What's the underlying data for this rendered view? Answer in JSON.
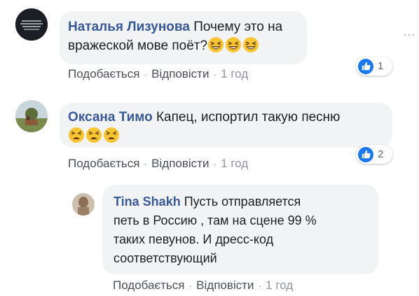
{
  "comments": [
    {
      "author": "Наталья Лизунова",
      "text_line1": "Почему это на",
      "text_line2": "вражеской мове поёт?",
      "emojis": [
        "laughing-face",
        "laughing-face",
        "laughing-face"
      ],
      "actions": {
        "like": "Подобається",
        "reply": "Відповісти",
        "time": "1 год"
      },
      "reaction_count": "1",
      "avatar": "dark-quote-image",
      "accent": "#385898"
    },
    {
      "author": "Оксана Тимо",
      "text_line1": "Капец, испортил такую песню",
      "emojis": [
        "tired-face",
        "tired-face",
        "tired-face"
      ],
      "actions": {
        "like": "Подобається",
        "reply": "Відповісти",
        "time": "1 год"
      },
      "reaction_count": "2",
      "avatar": "landscape-photo"
    },
    {
      "author": "Tina Shakh",
      "text_lines": [
        "Пусть отправляется",
        "петь в Россию , там на сцене 99 %",
        "таких певунов. И дресс-код",
        "соответствующий"
      ],
      "actions": {
        "like": "Подобається",
        "reply": "Відповісти",
        "time": "1 год"
      },
      "avatar": "portrait-photo"
    }
  ],
  "separator": "·",
  "more_icon": "more-horizontal-icon",
  "like_icon_color": "#1877f2"
}
